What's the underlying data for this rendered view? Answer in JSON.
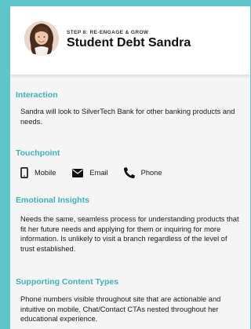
{
  "header": {
    "step_label": "STEP 8: RE-ENGAGE & GROW",
    "persona_name": "Student Debt Sandra"
  },
  "sections": {
    "interaction": {
      "heading": "Interaction",
      "text": "Sandra will look to SilverTech Bank for other banking products and needs."
    },
    "touchpoint": {
      "heading": "Touchpoint",
      "items": [
        {
          "label": "Mobile",
          "icon": "mobile-icon"
        },
        {
          "label": "Email",
          "icon": "email-icon"
        },
        {
          "label": "Phone",
          "icon": "phone-icon"
        }
      ]
    },
    "emotional": {
      "heading": "Emotional Insights",
      "text": "Needs the same, seamless process for understanding products that fit her future needs and applying for them or inquiring for more information. Is unlikely to visit a branch regardless of the level of trust established."
    },
    "content_types": {
      "heading": "Supporting Content Types",
      "text": "Phone numbers visible throughout site that are actionable and intuitive on mobile. Chat/Contact CTAs nested throughout her educational experience."
    }
  },
  "colors": {
    "background_teal": "#5ec5c8",
    "heading_teal": "#3bb3b8",
    "body_bg": "#f5f5f5"
  }
}
